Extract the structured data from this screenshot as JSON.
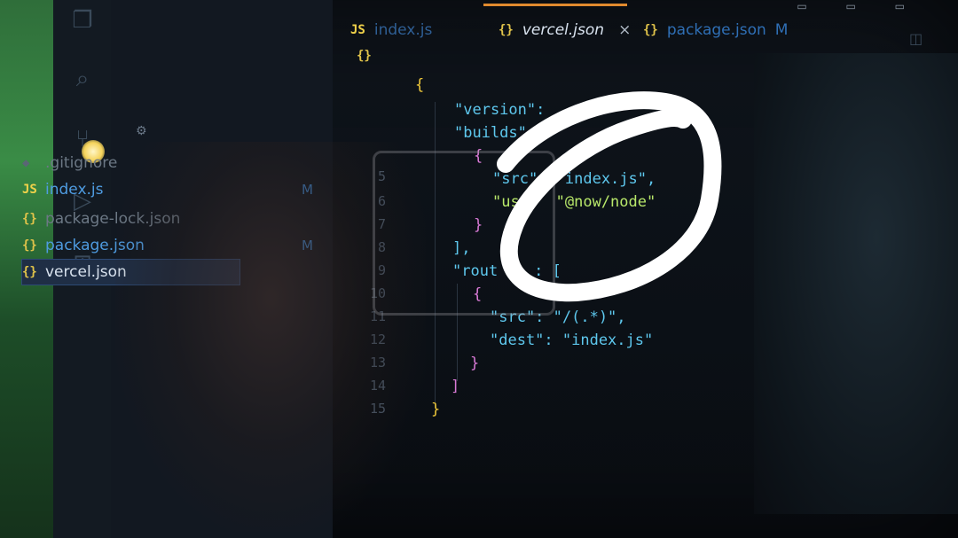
{
  "tabs": [
    {
      "icon": "JS",
      "label": "index.js",
      "active": false
    },
    {
      "icon": "{}",
      "label": "vercel.json",
      "close": "×",
      "active": true
    },
    {
      "icon": "{}",
      "label": "package.json",
      "badge": "M",
      "active": false
    }
  ],
  "explorer": {
    "items": [
      {
        "icon": "",
        "label": ".gitignore",
        "badge": ""
      },
      {
        "icon": "JS",
        "label": "index.js",
        "badge": "M"
      },
      {
        "icon": "{}",
        "label": "package-lock.json",
        "badge": ""
      },
      {
        "icon": "{}",
        "label": "package.json",
        "badge": "M"
      },
      {
        "icon": "{}",
        "label": "vercel.json",
        "badge": "",
        "selected": true
      }
    ]
  },
  "editor": {
    "breadcrumb_icon": "{}",
    "line_numbers": [
      "5",
      "6",
      "7",
      "8",
      "9",
      "10",
      "11",
      "12",
      "13",
      "14",
      "15"
    ],
    "lines": [
      "{",
      "\"version\":",
      "\"builds\"",
      "{",
      "\"src\"  \"index.js\",",
      "\"use   \"@now/node\"",
      "}",
      "],",
      "\"rout    : [",
      "{",
      "\"src\": \"/(.*)\",",
      "\"dest\": \"index.js\"",
      "}",
      "]",
      "}"
    ]
  },
  "colors": {
    "key": "#5ec8ee",
    "string": "#b8e86a",
    "brace": "#f0c93a",
    "bracket": "#d97ad6"
  }
}
